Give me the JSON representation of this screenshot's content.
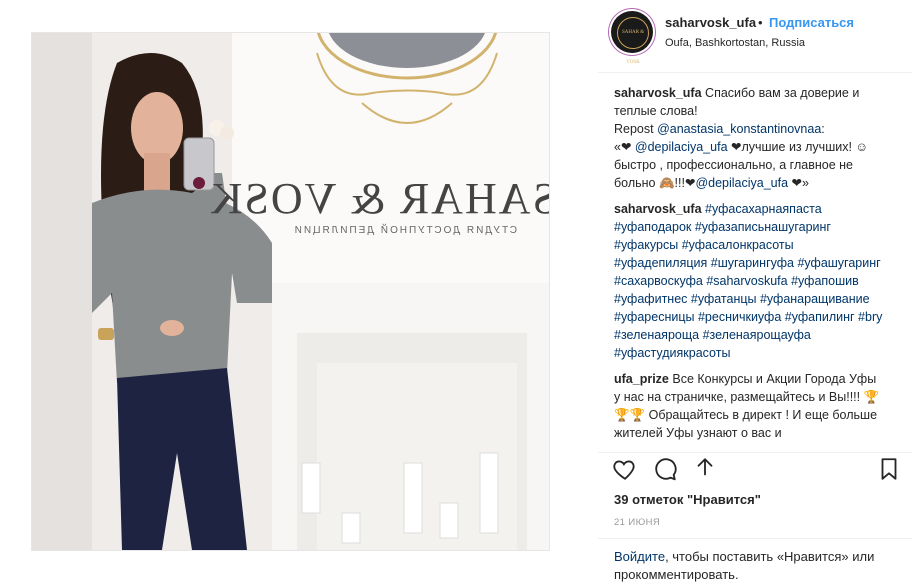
{
  "post": {
    "photo_sign": "SAHAR & VOSK",
    "photo_sign_sub": "СТУДИЯ ДОСТУПНОЙ ДЕПИЛЯЦИИ",
    "avatar_text": "SAHAR & VOSK"
  },
  "header": {
    "username": "saharvosk_ufa",
    "separator": "•",
    "follow_label": "Подписаться",
    "location": "Oufa, Bashkortostan, Russia"
  },
  "caption": {
    "username": "saharvosk_ufa",
    "text_1": "Спасибо вам за доверие и теплые слова!",
    "repost_label": "Repost ",
    "repost_mention": "@anastasia_konstantinovnaa",
    "repost_colon": ":",
    "line_2_prefix": "«❤ ",
    "mention_2": "@depilaciya_ufa",
    "line_2_mid": " ❤лучшие из лучших! ☺ быстро , профессионально, а главное не больно 🙈!!!❤",
    "mention_3": "@depilaciya_ufa",
    "line_2_suffix": " ❤»"
  },
  "hashtag_comment": {
    "username": "saharvosk_ufa",
    "tags": [
      "#уфасахарнаяпаста",
      "#уфаподарок",
      "#уфазаписьнашугаринг",
      "#уфакурсы",
      "#уфасалонкрасоты",
      "#уфадепиляция",
      "#шугарингуфа",
      "#уфашугаринг",
      "#сахарвоскуфа",
      "#saharvoskufa",
      "#уфапошив",
      "#уфафитнес",
      "#уфатанцы",
      "#уфанаращивание",
      "#уфаресницы",
      "#ресничкиуфа",
      "#уфапилинг",
      "#bry",
      "#зеленаяроща",
      "#зеленаярощауфа",
      "#уфастудиякрасоты"
    ]
  },
  "prize_comment": {
    "username": "ufa_prize",
    "text": "Все Конкурсы и Акции Города Уфы у нас на страничке, размещайтесь и Вы!!!! 🏆🏆🏆 Обращайтесь в директ ! И еще больше жителей Уфы узнают о вас и"
  },
  "actions": {
    "like_icon": "heart-icon",
    "comment_icon": "comment-icon",
    "share_icon": "share-icon",
    "save_icon": "bookmark-icon"
  },
  "stats": {
    "likes": "39 отметок \"Нравится\"",
    "date": "21 июня"
  },
  "login": {
    "login_link": "Войдите",
    "login_text": ", чтобы поставить «Нравится» или прокомментировать."
  }
}
